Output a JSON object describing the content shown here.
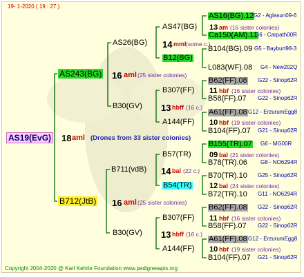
{
  "header": "19-   1-2020  ( 19 : 27 )",
  "footer": "Copyright 2004-2020 @ Karl Kehrle Foundation    www.pedigreeapis.org",
  "root": {
    "label": "AS19(EvG)",
    "num": "18",
    "mark": "aml",
    "note": "(Drones from 33 sister colonies)"
  },
  "sire": {
    "label": "AS243(BG)",
    "num": "16",
    "mark": "aml",
    "note": "(25 sister colonies)"
  },
  "dam": {
    "label": "B712(JtB)",
    "num": "16",
    "mark": "aml",
    "note": "(25 sister colonies)"
  },
  "level2": [
    {
      "label": "AS26(BG)",
      "num": "14",
      "mark": "mml",
      "note": "(some c.)"
    },
    {
      "label": "B30(GV)",
      "num": "13",
      "mark": "hbff",
      "note": "(16 c.)"
    },
    {
      "label": "B711(vdB)",
      "num": "14",
      "mark": "bal",
      "note": "(22 c.)"
    },
    {
      "label": "B30(GV)",
      "num": "13",
      "mark": "hbff",
      "note": "(16 c.)"
    }
  ],
  "level3": [
    {
      "label": "AS47(BG)",
      "num": "13",
      "mark": "am",
      "note": "(16 sister colonies)"
    },
    {
      "label": "B12(BG)",
      "num": "",
      "mark": "",
      "note": ""
    },
    {
      "label": "B307(FF)",
      "num": "11",
      "mark": "hbf",
      "note": "(16 sister colonies)"
    },
    {
      "label": "A144(FF)",
      "num": "10",
      "mark": "hbf",
      "note": "(19 sister colonies)"
    },
    {
      "label": "B57(TR)",
      "num": "09",
      "mark": "bal",
      "note": "(21 sister colonies)"
    },
    {
      "label": "B54(TR)",
      "num": "12",
      "mark": "bal",
      "note": "(24 sister colonies)"
    },
    {
      "label": "B307(FF)",
      "num": "11",
      "mark": "hbf",
      "note": "(16 sister colonies)"
    },
    {
      "label": "A144(FF)",
      "num": "10",
      "mark": "hbf",
      "note": "(19 sister colonies)"
    }
  ],
  "level4": [
    {
      "label": "AS16(BG).12",
      "bee": "G2 - Aglasun09-6"
    },
    {
      "label": "Ca150(AM).11",
      "bee": "G6 - Carpath00R"
    },
    {
      "label": "B104(BG).09",
      "bee": "G5 - Bayburt98-3"
    },
    {
      "label": "L083(WF).08",
      "bee": "G4 - New202Q"
    },
    {
      "label": "B62(FF).08",
      "bee": "G22 - Sinop62R"
    },
    {
      "label": "B58(FF).07",
      "bee": "G22 - Sinop62R"
    },
    {
      "label": "A61(FF).08",
      "bee": "G12 - ErzurumEgg8"
    },
    {
      "label": "B104(FF).07",
      "bee": "G21 - Sinop62R"
    },
    {
      "label": "B155(TR).07",
      "bee": "G6 - MG00R"
    },
    {
      "label": "B78(TR).06",
      "bee": "G8 - NO6294R"
    },
    {
      "label": "B70(TR).10",
      "bee": "G25 - Sinop62R"
    },
    {
      "label": "B72(TR).10",
      "bee": "G11 - NO6294R"
    },
    {
      "label": "B62(FF).08",
      "bee": "G22 - Sinop62R"
    },
    {
      "label": "B58(FF).07",
      "bee": "G22 - Sinop62R"
    },
    {
      "label": "A61(FF).08",
      "bee": "G12 - ErzurumEgg8"
    },
    {
      "label": "B104(FF).07",
      "bee": "G21 - Sinop62R"
    }
  ],
  "colors": {
    "line": "#006600",
    "root_bg": "#ffccff",
    "sire_bg": "#22dd22",
    "dam_bg": "#ffee22",
    "mark": "#cc0000",
    "note": "#7722aa",
    "bee": "#0000aa"
  }
}
